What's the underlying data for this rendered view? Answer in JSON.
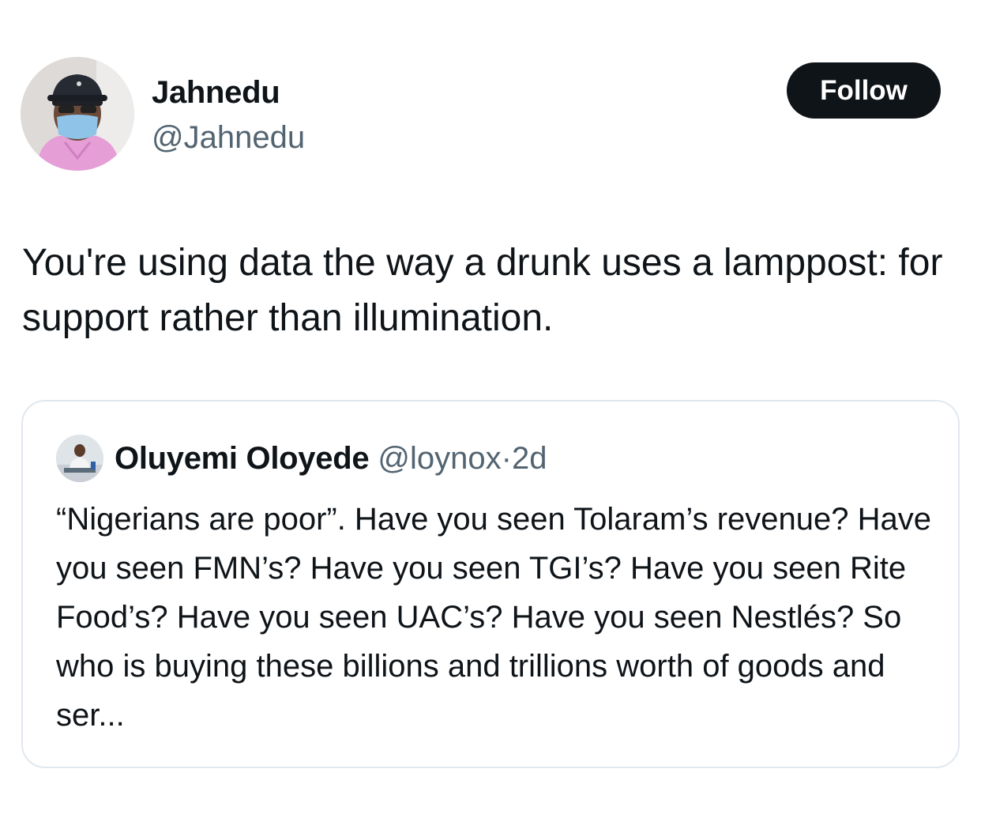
{
  "author": {
    "display_name": "Jahnedu",
    "handle": "@Jahnedu"
  },
  "follow_button": {
    "label": "Follow"
  },
  "tweet": {
    "text": "You're using data the way a drunk uses a lamppost: for support rather than illumination."
  },
  "quoted_tweet": {
    "display_name": "Oluyemi Oloyede",
    "handle": "@loynox",
    "separator": "·",
    "time": "2d",
    "text": "“Nigerians are poor”. Have you seen Tolaram’s revenue? Have you seen FMN’s? Have you seen TGI’s? Have you seen Rite Food’s? Have you seen UAC’s? Have you seen Nestlés? So who is buying these billions and trillions worth of goods and ser..."
  },
  "colors": {
    "text_primary": "#0f1419",
    "text_secondary": "#536471",
    "button_bg": "#0f1419",
    "card_border": "#e1e8ed"
  }
}
